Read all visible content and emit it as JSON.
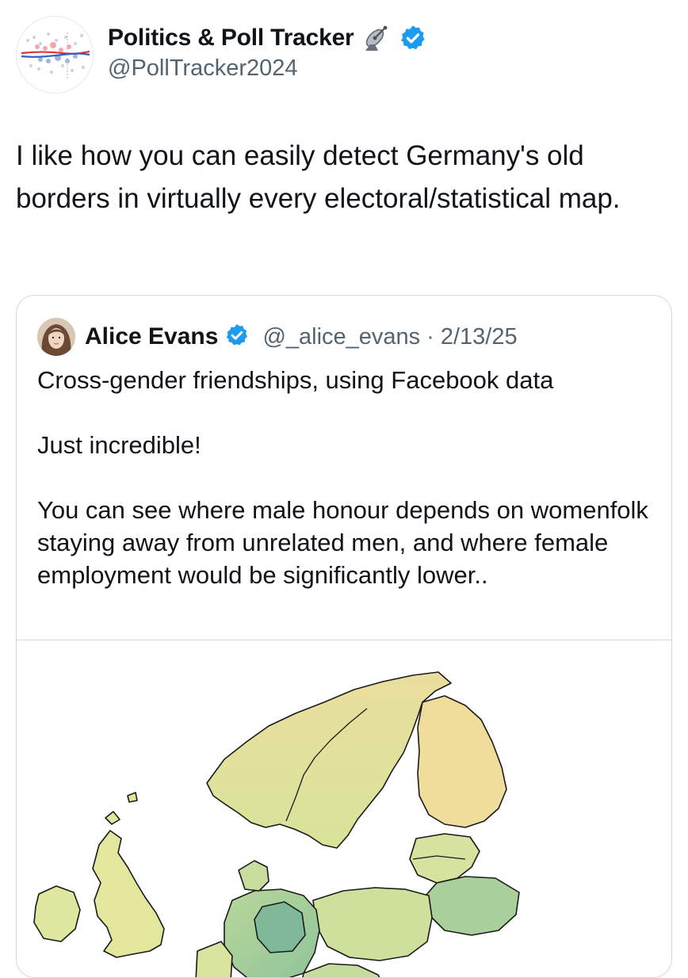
{
  "author": {
    "name": "Politics & Poll Tracker",
    "handle": "@PollTracker2024",
    "emoji_icon": "satellite-antenna-icon",
    "verified_icon": "verified-badge-icon",
    "badge_color": "#1d9bf0"
  },
  "tweet": {
    "text": "I like how you can easily detect Germany's old borders in virtually every electoral/statistical map."
  },
  "quote": {
    "name": "Alice Evans",
    "handle": "@_alice_evans",
    "separator": "·",
    "date": "2/13/25",
    "paragraphs": [
      "Cross-gender friendships, using Facebook data",
      "Just incredible!",
      "You can see where male honour depends on womenfolk staying away from unrelated men, and where female employment would be significantly lower.."
    ],
    "media_icon": "europe-map-image"
  }
}
